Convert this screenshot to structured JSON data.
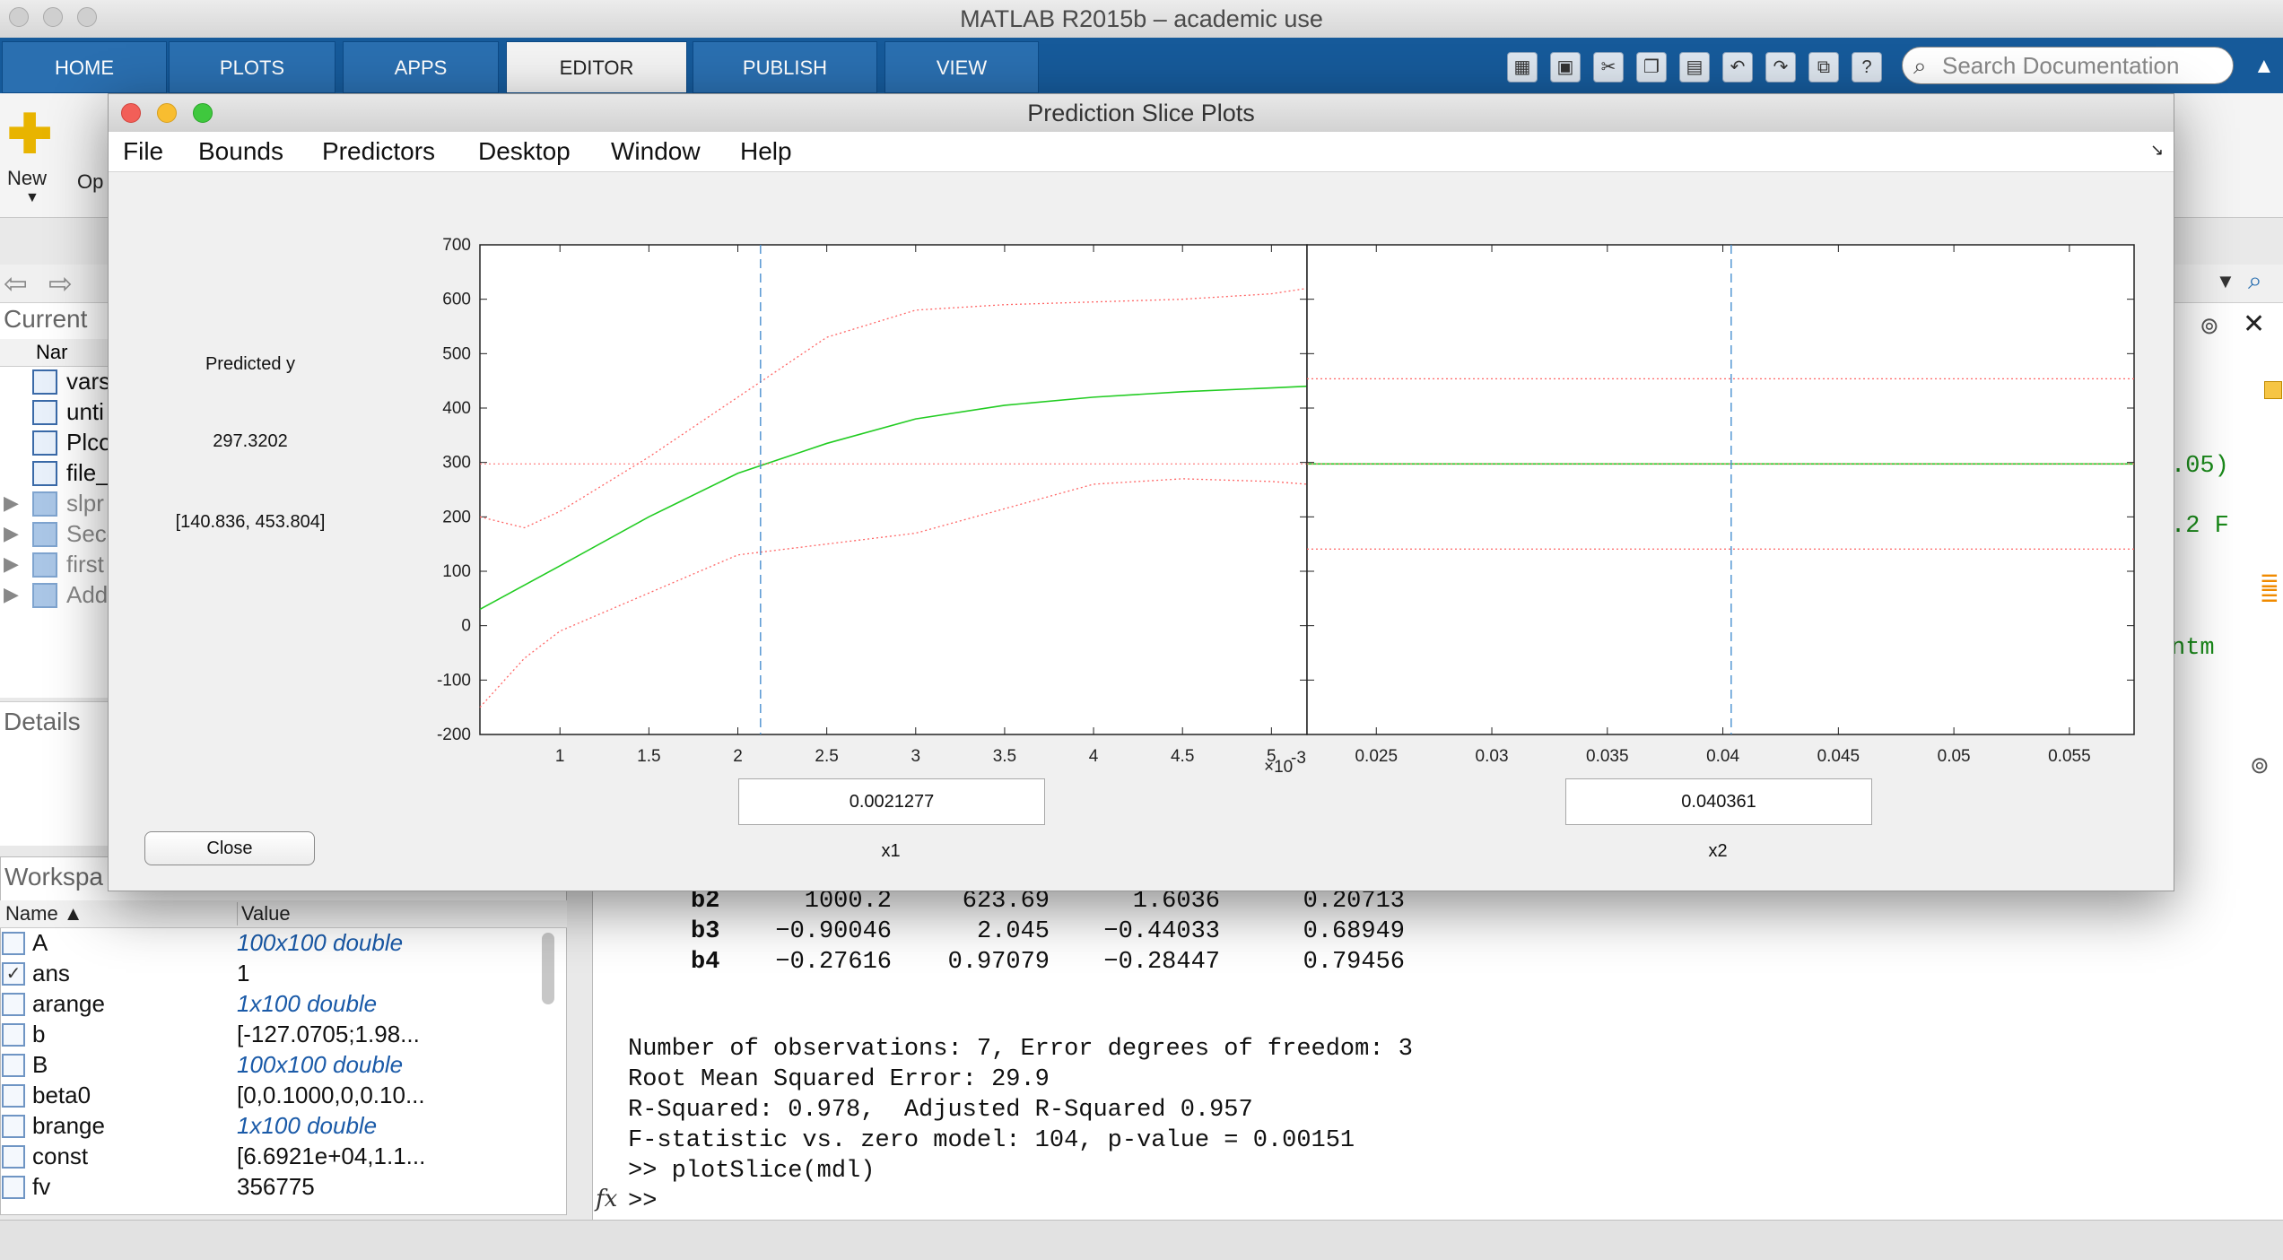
{
  "main_window": {
    "title": "MATLAB R2015b – academic use",
    "tabs": [
      "HOME",
      "PLOTS",
      "APPS",
      "EDITOR",
      "PUBLISH",
      "VIEW"
    ],
    "active_tab": "EDITOR",
    "search_placeholder": "Search Documentation",
    "new_label": "New",
    "open_label_partial": "Op"
  },
  "current_folder": {
    "title": "Current",
    "column": "Nar",
    "items": [
      {
        "name": "vars",
        "type": "file"
      },
      {
        "name": "unti",
        "type": "file"
      },
      {
        "name": "Plco",
        "type": "file"
      },
      {
        "name": "file_",
        "type": "file"
      },
      {
        "name": "slpr",
        "type": "folder"
      },
      {
        "name": "Seco",
        "type": "folder"
      },
      {
        "name": "first",
        "type": "folder"
      },
      {
        "name": "Add",
        "type": "folder"
      }
    ]
  },
  "details": {
    "title": "Details"
  },
  "workspace": {
    "title": "Workspa",
    "col_name": "Name ▲",
    "col_value": "Value",
    "rows": [
      {
        "name": "A",
        "value": "100x100 double",
        "italic": true
      },
      {
        "name": "ans",
        "value": "1",
        "italic": false
      },
      {
        "name": "arange",
        "value": "1x100 double",
        "italic": true
      },
      {
        "name": "b",
        "value": "[-127.0705;1.98...",
        "italic": false
      },
      {
        "name": "B",
        "value": "100x100 double",
        "italic": true
      },
      {
        "name": "beta0",
        "value": "[0,0.1000,0,0.10...",
        "italic": false
      },
      {
        "name": "brange",
        "value": "1x100 double",
        "italic": true
      },
      {
        "name": "const",
        "value": "[6.6921e+04,1.1...",
        "italic": false
      },
      {
        "name": "fv",
        "value": "356775",
        "italic": false
      }
    ]
  },
  "command_window": {
    "coef_rows": [
      {
        "name": "b2",
        "c1": "1000.2",
        "c2": "623.69",
        "c3": "1.6036",
        "c4": "0.20713"
      },
      {
        "name": "b3",
        "c1": "−0.90046",
        "c2": "2.045",
        "c3": "−0.44033",
        "c4": "0.68949"
      },
      {
        "name": "b4",
        "c1": "−0.27616",
        "c2": "0.97079",
        "c3": "−0.28447",
        "c4": "0.79456"
      }
    ],
    "lines": [
      "Number of observations: 7, Error degrees of freedom: 3",
      "Root Mean Squared Error: 29.9",
      "R-Squared: 0.978,  Adjusted R-Squared 0.957",
      "F-statistic vs. zero model: 104, p-value = 0.00151",
      ">> plotSlice(mdl)",
      ">> "
    ],
    "right_partial": [
      ".05)",
      ".2 F",
      "ntm"
    ]
  },
  "figure": {
    "title": "Prediction Slice Plots",
    "menu": [
      "File",
      "Bounds",
      "Predictors",
      "Desktop",
      "Window",
      "Help"
    ],
    "predicted_label": "Predicted y",
    "predicted_value": "297.3202",
    "confidence_interval": "[140.836, 453.804]",
    "close_label": "Close",
    "x1_value": "0.0021277",
    "x1_label": "x1",
    "x2_value": "0.040361",
    "x2_label": "x2",
    "x1_exponent": "×10",
    "x1_exponent_power": "-3"
  },
  "chart_data": [
    {
      "type": "line",
      "xlabel": "x1",
      "ylim": [
        -200,
        700
      ],
      "xlim": [
        0.00055,
        0.0052
      ],
      "yticks": [
        -200,
        -100,
        0,
        100,
        200,
        300,
        400,
        500,
        600,
        700
      ],
      "xticks": [
        0.001,
        0.0015,
        0.002,
        0.0025,
        0.003,
        0.0035,
        0.004,
        0.0045,
        0.005
      ],
      "xtick_labels": [
        "1",
        "1.5",
        "2",
        "2.5",
        "3",
        "3.5",
        "4",
        "4.5",
        "5"
      ],
      "current_x": 0.0021277,
      "current_y": 297.3202,
      "series": [
        {
          "role": "prediction",
          "color": "#22cc22",
          "x": [
            0.00055,
            0.001,
            0.0015,
            0.002,
            0.0025,
            0.003,
            0.0035,
            0.004,
            0.0045,
            0.005,
            0.0052
          ],
          "y": [
            30,
            110,
            200,
            280,
            335,
            380,
            405,
            420,
            430,
            437,
            440
          ]
        },
        {
          "role": "upper_bound",
          "color": "#ff6666",
          "x": [
            0.00055,
            0.0008,
            0.001,
            0.0015,
            0.002,
            0.0025,
            0.003,
            0.0035,
            0.004,
            0.0045,
            0.005,
            0.0052
          ],
          "y": [
            200,
            180,
            210,
            310,
            420,
            530,
            580,
            590,
            595,
            600,
            610,
            620
          ]
        },
        {
          "role": "lower_bound",
          "color": "#ff6666",
          "x": [
            0.00055,
            0.0008,
            0.001,
            0.0015,
            0.002,
            0.0025,
            0.003,
            0.0035,
            0.004,
            0.0045,
            0.005,
            0.0052
          ],
          "y": [
            -150,
            -60,
            -10,
            60,
            130,
            150,
            170,
            215,
            260,
            270,
            265,
            260
          ]
        }
      ]
    },
    {
      "type": "line",
      "xlabel": "x2",
      "ylim": [
        -200,
        700
      ],
      "xlim": [
        0.022,
        0.0578
      ],
      "xticks": [
        0.025,
        0.03,
        0.035,
        0.04,
        0.045,
        0.05,
        0.055
      ],
      "xtick_labels": [
        "0.025",
        "0.03",
        "0.035",
        "0.04",
        "0.045",
        "0.05",
        "0.055"
      ],
      "current_x": 0.040361,
      "series": [
        {
          "role": "prediction",
          "color": "#22cc22",
          "x": [
            0.022,
            0.0578
          ],
          "y": [
            297.3,
            297.3
          ]
        },
        {
          "role": "upper_bound",
          "color": "#ff6666",
          "x": [
            0.022,
            0.0578
          ],
          "y": [
            453.8,
            453.8
          ]
        },
        {
          "role": "lower_bound",
          "color": "#ff6666",
          "x": [
            0.022,
            0.0578
          ],
          "y": [
            140.8,
            140.8
          ]
        }
      ]
    }
  ]
}
